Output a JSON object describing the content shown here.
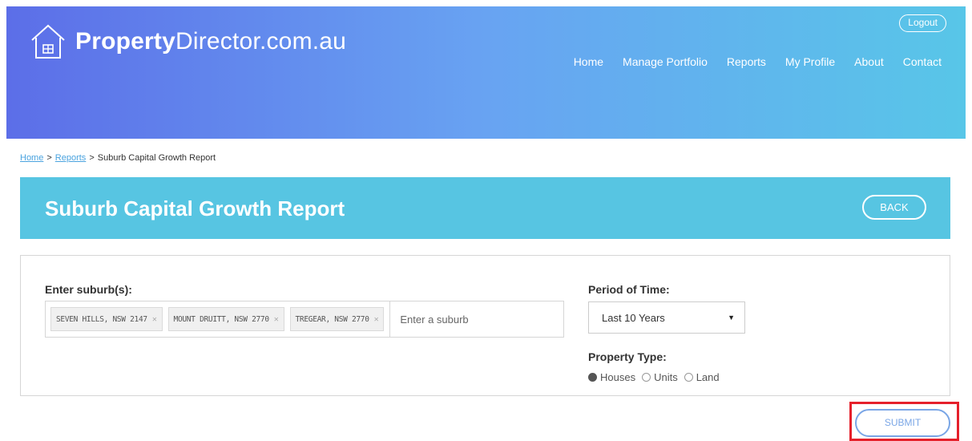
{
  "header": {
    "logo_bold": "Property",
    "logo_rest": "Director.com.au",
    "logout_label": "Logout",
    "nav": [
      "Home",
      "Manage Portfolio",
      "Reports",
      "My Profile",
      "About",
      "Contact"
    ]
  },
  "breadcrumb": {
    "home": "Home",
    "reports": "Reports",
    "current": "Suburb Capital Growth Report",
    "separator": ">"
  },
  "banner": {
    "title": "Suburb Capital Growth Report",
    "back_label": "BACK"
  },
  "form": {
    "suburb_label": "Enter suburb(s):",
    "suburb_tags": [
      "SEVEN HILLS, NSW 2147",
      "MOUNT DRUITT, NSW 2770",
      "TREGEAR, NSW 2770"
    ],
    "suburb_placeholder": "Enter a suburb",
    "period_label": "Period of Time:",
    "period_value": "Last 10 Years",
    "property_type_label": "Property Type:",
    "property_types": [
      "Houses",
      "Units",
      "Land"
    ],
    "property_type_selected": "Houses",
    "submit_label": "SUBMIT"
  },
  "colors": {
    "banner": "#57c5e2",
    "submit_outline": "#e5202b",
    "link": "#4aa3df"
  }
}
